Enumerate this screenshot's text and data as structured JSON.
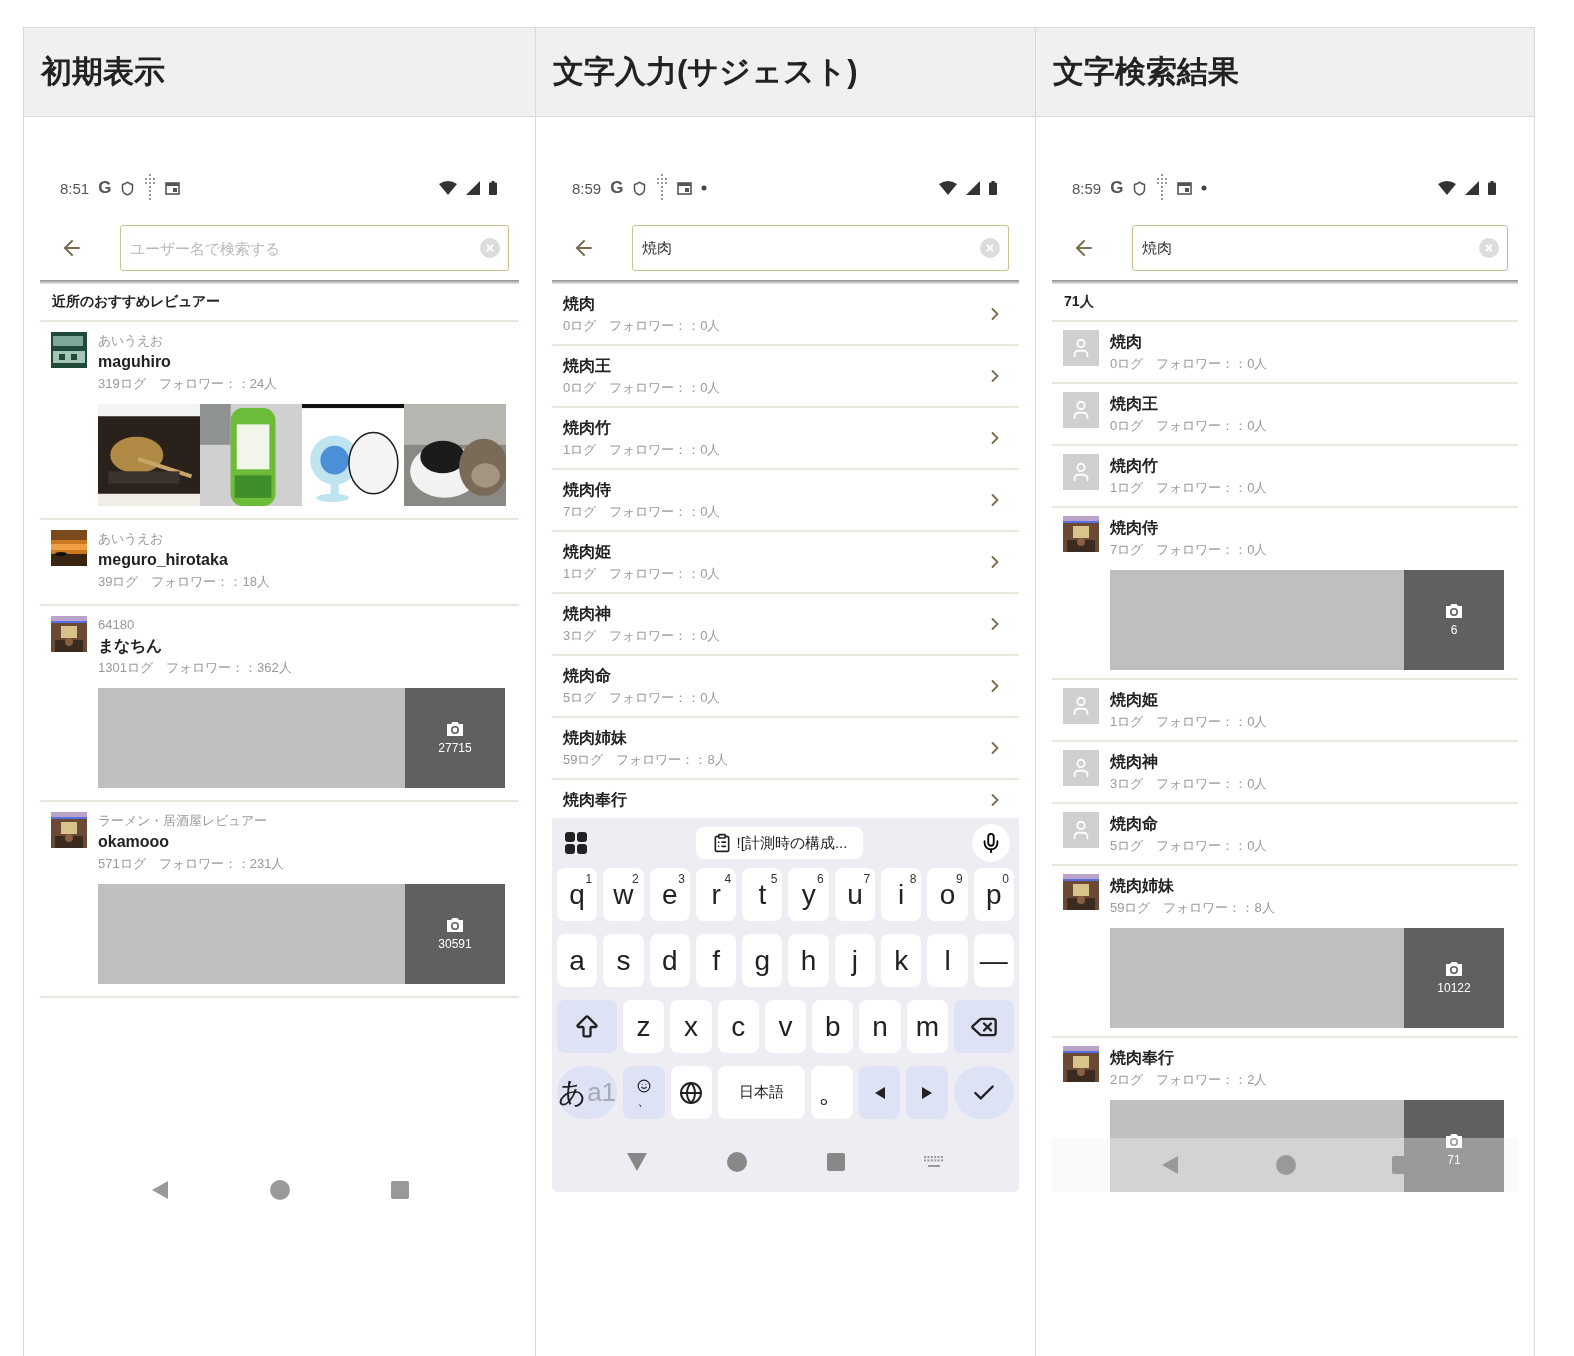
{
  "columns": [
    {
      "title": "初期表示",
      "phone": {
        "status": {
          "time": "8:51",
          "logo": "G",
          "notification_dot": false
        },
        "search": {
          "placeholder": "ユーザー名で検索する"
        },
        "list_header": "近所のおすすめレビュアー",
        "nav": {
          "kind": "bar"
        },
        "items": [
          {
            "subtitle": "あいうえお",
            "name": "maguhiro",
            "stats": "319ログ　フォロワー：：24人",
            "media": {
              "kind": "photos"
            }
          },
          {
            "subtitle": "あいうえお",
            "name": "meguro_hirotaka",
            "stats": "39ログ　フォロワー：：18人"
          },
          {
            "subtitle": "64180",
            "name": "まなちん",
            "stats": "1301ログ　フォロワー：：362人",
            "media": {
              "kind": "count",
              "count": "27715"
            }
          },
          {
            "subtitle": "ラーメン・居酒屋レビュアー",
            "name": "okamooo",
            "stats": "571ログ　フォロワー：：231人",
            "media": {
              "kind": "count",
              "count": "30591"
            }
          }
        ]
      }
    },
    {
      "title": "文字入力(サジェスト)",
      "phone": {
        "status": {
          "time": "8:59",
          "logo": "G",
          "notification_dot": true
        },
        "search": {
          "value": "焼肉"
        },
        "nav": {
          "kind": "keyboard"
        },
        "items": [
          {
            "name": "焼肉",
            "stats": "0ログ　フォロワー：：0人",
            "chevron": true
          },
          {
            "name": "焼肉王",
            "stats": "0ログ　フォロワー：：0人",
            "chevron": true
          },
          {
            "name": "焼肉竹",
            "stats": "1ログ　フォロワー：：0人",
            "chevron": true
          },
          {
            "name": "焼肉侍",
            "stats": "7ログ　フォロワー：：0人",
            "chevron": true
          },
          {
            "name": "焼肉姫",
            "stats": "1ログ　フォロワー：：0人",
            "chevron": true
          },
          {
            "name": "焼肉神",
            "stats": "3ログ　フォロワー：：0人",
            "chevron": true
          },
          {
            "name": "焼肉命",
            "stats": "5ログ　フォロワー：：0人",
            "chevron": true
          },
          {
            "name": "焼肉姉妹",
            "stats": "59ログ　フォロワー：：8人",
            "chevron": true
          },
          {
            "name": "焼肉奉行",
            "chevron": true
          }
        ],
        "keyboard": {
          "clipboard": "![計測時の構成...",
          "rows": [
            [
              {
                "kind": "char",
                "label": "q",
                "hint": "1"
              },
              {
                "kind": "char",
                "label": "w",
                "hint": "2"
              },
              {
                "kind": "char",
                "label": "e",
                "hint": "3"
              },
              {
                "kind": "char",
                "label": "r",
                "hint": "4"
              },
              {
                "kind": "char",
                "label": "t",
                "hint": "5"
              },
              {
                "kind": "char",
                "label": "y",
                "hint": "6"
              },
              {
                "kind": "char",
                "label": "u",
                "hint": "7"
              },
              {
                "kind": "char",
                "label": "i",
                "hint": "8"
              },
              {
                "kind": "char",
                "label": "o",
                "hint": "9"
              },
              {
                "kind": "char",
                "label": "p",
                "hint": "0"
              }
            ],
            [
              {
                "kind": "char",
                "label": "a"
              },
              {
                "kind": "char",
                "label": "s"
              },
              {
                "kind": "char",
                "label": "d"
              },
              {
                "kind": "char",
                "label": "f"
              },
              {
                "kind": "char",
                "label": "g"
              },
              {
                "kind": "char",
                "label": "h"
              },
              {
                "kind": "char",
                "label": "j"
              },
              {
                "kind": "char",
                "label": "k"
              },
              {
                "kind": "char",
                "label": "l"
              },
              {
                "kind": "char",
                "label": "—"
              }
            ],
            [
              {
                "kind": "shift"
              },
              {
                "kind": "char",
                "label": "z"
              },
              {
                "kind": "char",
                "label": "x"
              },
              {
                "kind": "char",
                "label": "c"
              },
              {
                "kind": "char",
                "label": "v"
              },
              {
                "kind": "char",
                "label": "b"
              },
              {
                "kind": "char",
                "label": "n"
              },
              {
                "kind": "char",
                "label": "m"
              },
              {
                "kind": "backspace"
              }
            ],
            [
              {
                "kind": "mode",
                "label": "あ",
                "sub": "a1"
              },
              {
                "kind": "emoji",
                "label": "、"
              },
              {
                "kind": "globe"
              },
              {
                "kind": "space",
                "label": "日本語"
              },
              {
                "kind": "char",
                "label": "。"
              },
              {
                "kind": "left"
              },
              {
                "kind": "right"
              },
              {
                "kind": "enter"
              }
            ]
          ]
        }
      }
    },
    {
      "title": "文字検索結果",
      "phone": {
        "status": {
          "time": "8:59",
          "logo": "G",
          "notification_dot": true
        },
        "search": {
          "value": "焼肉"
        },
        "list_header": "71人",
        "nav": {
          "kind": "overlay"
        },
        "items": [
          {
            "avatar": {
              "kind": "placeholder"
            },
            "name": "焼肉",
            "stats": "0ログ　フォロワー：：0人"
          },
          {
            "avatar": {
              "kind": "placeholder"
            },
            "name": "焼肉王",
            "stats": "0ログ　フォロワー：：0人"
          },
          {
            "avatar": {
              "kind": "placeholder"
            },
            "name": "焼肉竹",
            "stats": "1ログ　フォロワー：：0人"
          },
          {
            "name": "焼肉侍",
            "stats": "7ログ　フォロワー：：0人",
            "media": {
              "kind": "count",
              "count": "6"
            }
          },
          {
            "avatar": {
              "kind": "placeholder"
            },
            "name": "焼肉姫",
            "stats": "1ログ　フォロワー：：0人"
          },
          {
            "avatar": {
              "kind": "placeholder"
            },
            "name": "焼肉神",
            "stats": "3ログ　フォロワー：：0人"
          },
          {
            "avatar": {
              "kind": "placeholder"
            },
            "name": "焼肉命",
            "stats": "5ログ　フォロワー：：0人"
          },
          {
            "name": "焼肉姉妹",
            "stats": "59ログ　フォロワー：：8人",
            "media": {
              "kind": "count",
              "count": "10122"
            }
          },
          {
            "name": "焼肉奉行",
            "stats": "2ログ　フォロワー：：2人",
            "media": {
              "kind": "count",
              "count": "71"
            }
          }
        ]
      }
    }
  ]
}
